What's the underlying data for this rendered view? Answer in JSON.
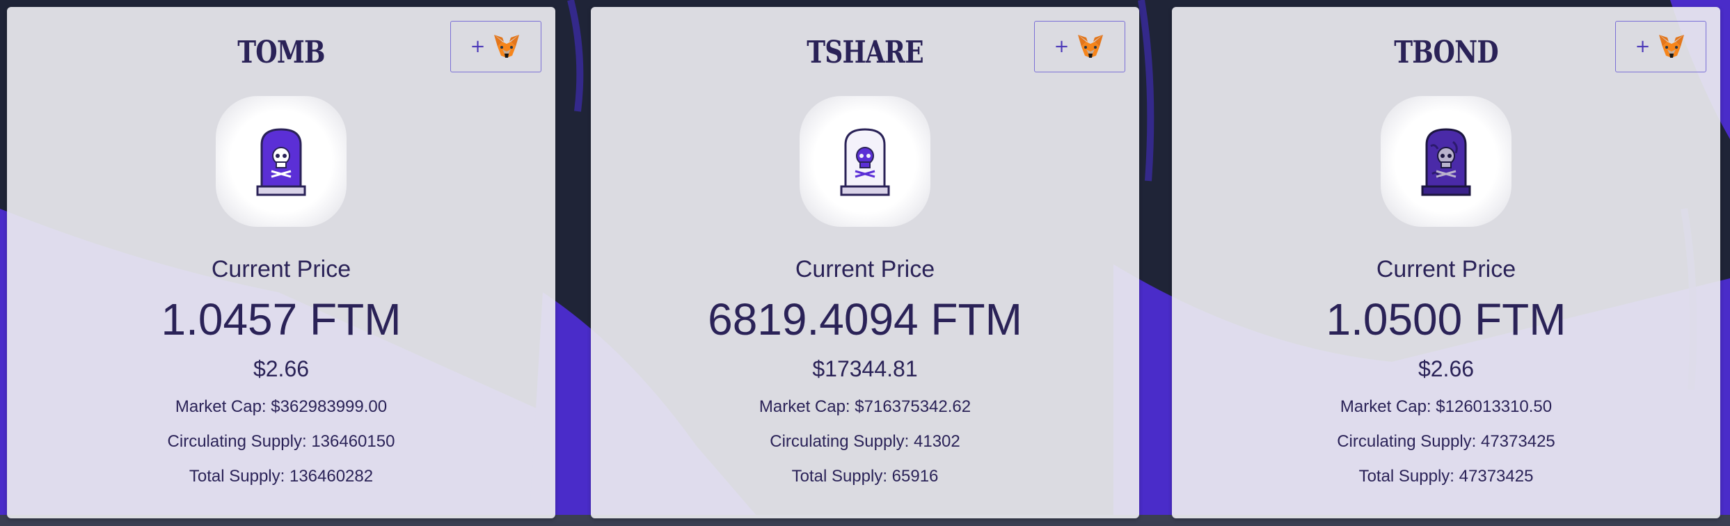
{
  "cards": [
    {
      "title": "TOMB",
      "add_button": {
        "plus": "+",
        "icon": "metamask-fox-icon"
      },
      "token_icon": "tombstone-purple-icon",
      "current_price_label": "Current Price",
      "price_ftm": "1.0457 FTM",
      "price_usd": "$2.66",
      "market_cap": "Market Cap: $362983999.00",
      "circulating_supply": "Circulating Supply: 136460150",
      "total_supply": "Total Supply: 136460282"
    },
    {
      "title": "TSHARE",
      "add_button": {
        "plus": "+",
        "icon": "metamask-fox-icon"
      },
      "token_icon": "tombstone-white-icon",
      "current_price_label": "Current Price",
      "price_ftm": "6819.4094 FTM",
      "price_usd": "$17344.81",
      "market_cap": "Market Cap: $716375342.62",
      "circulating_supply": "Circulating Supply: 41302",
      "total_supply": "Total Supply: 65916"
    },
    {
      "title": "TBOND",
      "add_button": {
        "plus": "+",
        "icon": "metamask-fox-icon"
      },
      "token_icon": "tombstone-dark-purple-icon",
      "current_price_label": "Current Price",
      "price_ftm": "1.0500 FTM",
      "price_usd": "$2.66",
      "market_cap": "Market Cap: $126013310.50",
      "circulating_supply": "Circulating Supply: 47373425",
      "total_supply": "Total Supply: 47373425"
    }
  ],
  "colors": {
    "text": "#2a2257",
    "accent": "#4a37b8",
    "background": "#1f2437",
    "card": "#ececf0"
  }
}
